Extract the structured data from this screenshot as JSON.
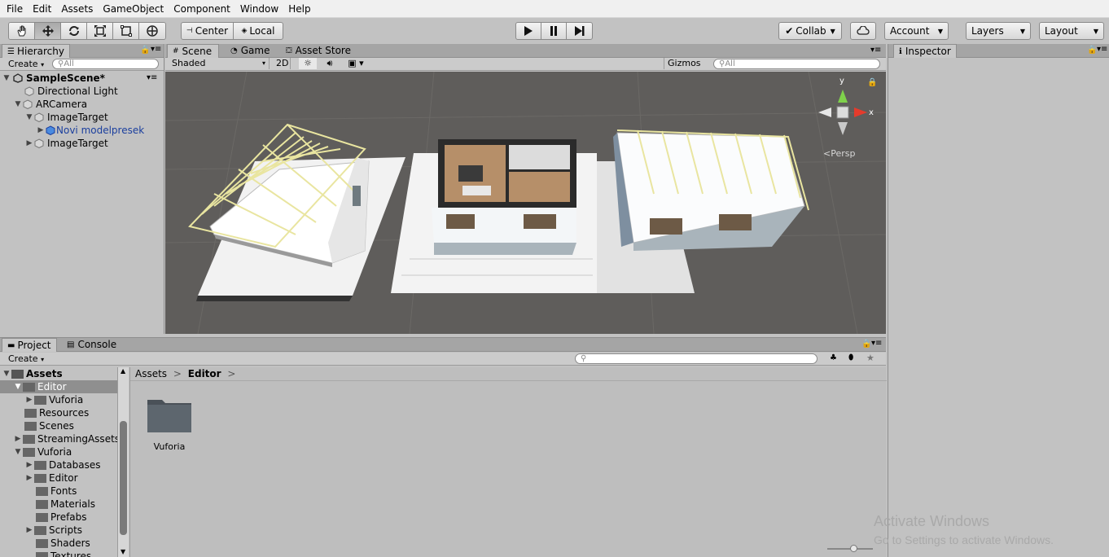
{
  "menu": [
    "File",
    "Edit",
    "Assets",
    "GameObject",
    "Component",
    "Window",
    "Help"
  ],
  "toolbar": {
    "pivot_label": "Center",
    "space_label": "Local",
    "collab_label": "Collab",
    "account_label": "Account",
    "layers_label": "Layers",
    "layout_label": "Layout"
  },
  "hierarchy": {
    "tab": "Hierarchy",
    "create": "Create",
    "search_placeholder": "All",
    "scene_name": "SampleScene*",
    "items": [
      {
        "label": "Directional Light"
      },
      {
        "label": "ARCamera"
      },
      {
        "label": "ImageTarget"
      },
      {
        "label": "Novi modelpresek"
      },
      {
        "label": "ImageTarget"
      }
    ]
  },
  "scene": {
    "tabs": [
      "Scene",
      "Game",
      "Asset Store"
    ],
    "shading": "Shaded",
    "mode_2d": "2D",
    "gizmos": "Gizmos",
    "search_placeholder": "All",
    "persp": "Persp",
    "axis_y": "y",
    "axis_x": "x"
  },
  "inspector": {
    "tab": "Inspector"
  },
  "project": {
    "tabs": [
      "Project",
      "Console"
    ],
    "create": "Create",
    "breadcrumb_root": "Assets",
    "breadcrumb_current": "Editor",
    "tree": [
      {
        "label": "Assets"
      },
      {
        "label": "Editor"
      },
      {
        "label": "Vuforia"
      },
      {
        "label": "Resources"
      },
      {
        "label": "Scenes"
      },
      {
        "label": "StreamingAssets"
      },
      {
        "label": "Vuforia"
      },
      {
        "label": "Databases"
      },
      {
        "label": "Editor"
      },
      {
        "label": "Fonts"
      },
      {
        "label": "Materials"
      },
      {
        "label": "Prefabs"
      },
      {
        "label": "Scripts"
      },
      {
        "label": "Shaders"
      },
      {
        "label": "Textures"
      }
    ],
    "grid_items": [
      {
        "label": "Vuforia"
      }
    ]
  },
  "watermark": {
    "line1": "Activate Windows",
    "line2": "Go to Settings to activate Windows."
  },
  "colors": {
    "selection_blue": "#3e7ce0",
    "scene_bg": "#5f5d5b",
    "prefab_blue": "#1b3f9e"
  }
}
